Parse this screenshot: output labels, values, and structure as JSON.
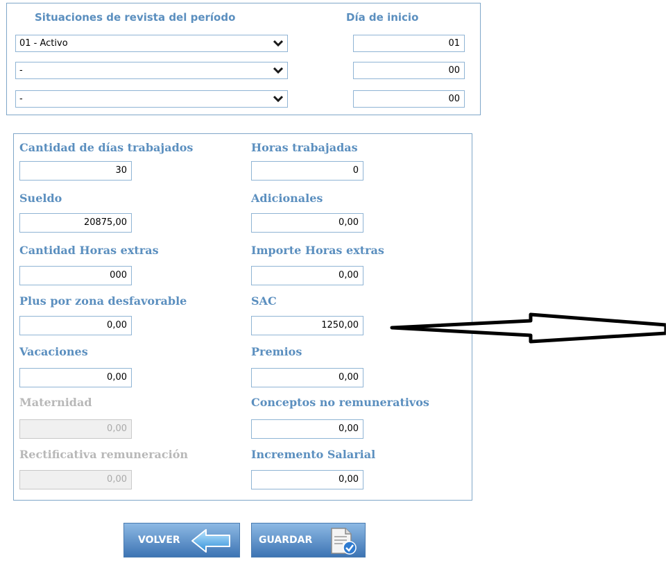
{
  "period": {
    "header_situaciones": "Situaciones de revista del período",
    "header_dia": "Día de inicio",
    "rows": [
      {
        "situacion": "01 - Activo",
        "dia": "01"
      },
      {
        "situacion": "-",
        "dia": "00"
      },
      {
        "situacion": "-",
        "dia": "00"
      }
    ]
  },
  "fields": {
    "dias_trabajados": {
      "label": "Cantidad de días trabajados",
      "value": "30"
    },
    "horas_trabajadas": {
      "label": "Horas trabajadas",
      "value": "0"
    },
    "sueldo": {
      "label": "Sueldo",
      "value": "20875,00"
    },
    "adicionales": {
      "label": "Adicionales",
      "value": "0,00"
    },
    "cant_horas_extras": {
      "label": "Cantidad Horas extras",
      "value": "000"
    },
    "importe_horas_extras": {
      "label": "Importe Horas extras",
      "value": "0,00"
    },
    "plus_zona": {
      "label": "Plus por zona desfavorable",
      "value": "0,00"
    },
    "sac": {
      "label": "SAC",
      "value": "1250,00"
    },
    "vacaciones": {
      "label": "Vacaciones",
      "value": "0,00"
    },
    "premios": {
      "label": "Premios",
      "value": "0,00"
    },
    "maternidad": {
      "label": "Maternidad",
      "value": "0,00"
    },
    "conceptos_no_rem": {
      "label": "Conceptos no remunerativos",
      "value": "0,00"
    },
    "rectificativa": {
      "label": "Rectificativa  remuneración",
      "value": "0,00"
    },
    "incremento": {
      "label": "Incremento Salarial",
      "value": "0,00"
    }
  },
  "buttons": {
    "volver": "VOLVER",
    "guardar": "GUARDAR"
  },
  "colors": {
    "label": "#5b8fbf",
    "border": "#8fb4d4",
    "disabled_text": "#b8b8b8",
    "button": "#3d74b4"
  },
  "icons": {
    "select_chevron": "chevron-down-icon",
    "volver": "arrow-left-icon",
    "guardar": "document-check-icon",
    "annotation": "hollow-arrow-left-icon"
  }
}
